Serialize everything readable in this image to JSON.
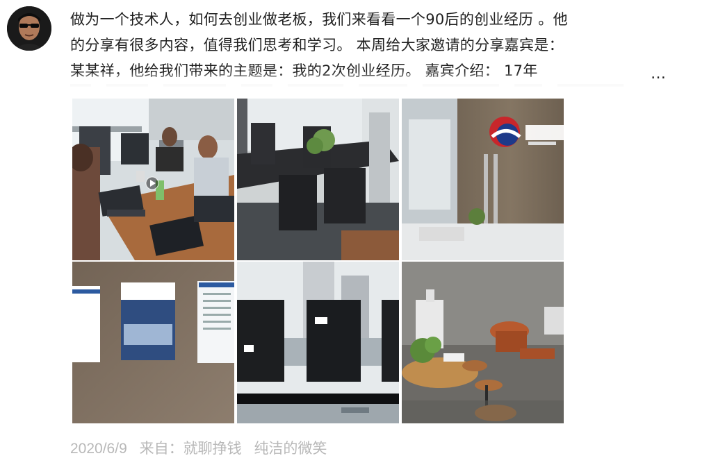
{
  "post": {
    "author_avatar": "avatar-icon",
    "lines": [
      "做为一个技术人，如何去创业做老板，我们来看看一个90后的创业经历 。他",
      "的分享有很多内容，值得我们思考和学习。  本周给大家邀请的分享嘉宾是：",
      "某某祥，他给我们带来的主题是：我的2次创业经历。  嘉宾介绍：  17年"
    ],
    "more_label": "…"
  },
  "photos": [
    {
      "name": "photo-office-team"
    },
    {
      "name": "photo-meeting-room"
    },
    {
      "name": "photo-reception-logo"
    },
    {
      "name": "photo-wall-posters"
    },
    {
      "name": "photo-window-view"
    },
    {
      "name": "photo-lounge-area"
    }
  ],
  "footer": {
    "date": "2020/6/9",
    "from_label": "来自：",
    "source": "就聊挣钱",
    "user": "纯洁的微笑"
  },
  "colors": {
    "text": "#1f1f1f",
    "footer": "#b8b8b8"
  }
}
